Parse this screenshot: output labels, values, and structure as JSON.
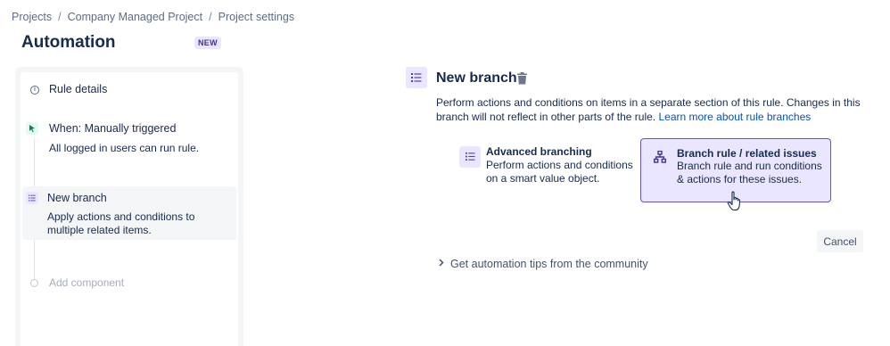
{
  "breadcrumb": {
    "items": [
      "Projects",
      "Company Managed Project",
      "Project settings"
    ],
    "separator": "/"
  },
  "header": {
    "title": "Automation",
    "badge": "NEW"
  },
  "rule_panel": {
    "rule_details_label": "Rule details",
    "trigger": {
      "title": "When: Manually triggered",
      "desc": "All logged in users can run rule."
    },
    "branch": {
      "title": "New branch",
      "desc": "Apply actions and conditions to multiple related items."
    },
    "add_component_label": "Add component"
  },
  "main": {
    "title": "New branch",
    "description": "Perform actions and conditions on items in a separate section of this rule. Changes in this branch will not reflect in other parts of the rule.",
    "learn_more_link": "Learn more about rule branches",
    "options": [
      {
        "title": "Advanced branching",
        "desc": "Perform actions and conditions on a smart value object."
      },
      {
        "title": "Branch rule / related issues",
        "desc": "Branch rule and run conditions & actions for these issues."
      }
    ],
    "cancel_label": "Cancel",
    "tips_label": "Get automation tips from the community"
  },
  "colors": {
    "accent_purple": "#6554c0",
    "selected_bg": "#eae6ff",
    "link": "#0052cc",
    "trigger_green": "#00875a"
  },
  "icons": {
    "rule_details": "info-icon",
    "trigger": "cursor-click-icon",
    "branch": "list-icon",
    "delete": "trash-icon",
    "related_issues": "hierarchy-icon",
    "tips": "chevron-right-icon"
  }
}
